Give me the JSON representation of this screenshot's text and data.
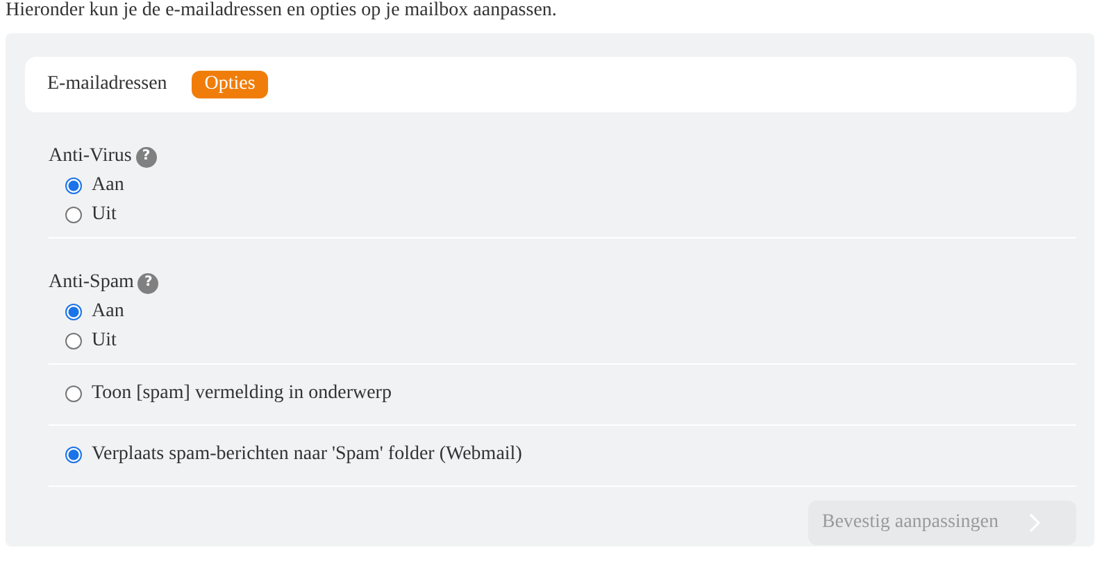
{
  "intro": "Hieronder kun je de e-mailadressen en opties op je mailbox aanpassen.",
  "tabs": [
    {
      "label": "E-mailadressen",
      "selected": false
    },
    {
      "label": "Opties",
      "selected": true
    }
  ],
  "groups": [
    {
      "title": "Anti-Virus",
      "help": "?",
      "options": [
        {
          "label": "Aan",
          "selected": true
        },
        {
          "label": "Uit",
          "selected": false
        }
      ]
    },
    {
      "title": "Anti-Spam",
      "help": "?",
      "options": [
        {
          "label": "Aan",
          "selected": true
        },
        {
          "label": "Uit",
          "selected": false
        }
      ]
    }
  ],
  "spam_options": [
    {
      "label": "Toon [spam] vermelding in onderwerp",
      "selected": false
    },
    {
      "label": "Verplaats spam-berichten naar 'Spam' folder (Webmail)",
      "selected": true
    }
  ],
  "submit": {
    "label": "Bevestig aanpassingen",
    "disabled": true
  }
}
